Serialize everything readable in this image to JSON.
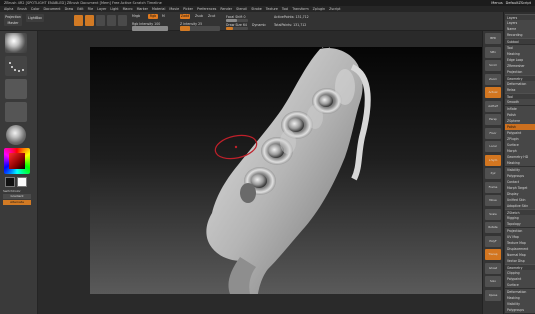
{
  "window": {
    "title": "ZBrush 4R2 [SPOTLIGHT ENABLED]  ZBrush Document  [Mem] Free  Active  Scratch  Timeline",
    "menus_label": "Menus",
    "default_script_label": "DefaultZScript"
  },
  "menubar": {
    "items": [
      "Alpha",
      "Brush",
      "Color",
      "Document",
      "Draw",
      "Edit",
      "File",
      "Layer",
      "Light",
      "Macro",
      "Marker",
      "Material",
      "Movie",
      "Picker",
      "Preferences",
      "Render",
      "Stencil",
      "Stroke",
      "Texture",
      "Tool",
      "Transform",
      "Zplugin",
      "Zscript"
    ]
  },
  "toolbar": {
    "projection_master": "Projection Master",
    "lightbox": "LightBox",
    "edit": "Edit",
    "draw": "Draw",
    "move": "Move",
    "scale": "Scale",
    "rotate": "Rotate",
    "mrgb": "Mrgb",
    "rgb": "Rgb",
    "m": "M",
    "zadd": "Zadd",
    "zsub": "Zsub",
    "zcut": "Zcut",
    "rgb_intensity": "Rgb Intensity 100",
    "z_intensity": "Z Intensity 25",
    "focal_shift": "Focal Shift 0",
    "draw_size": "Draw Size 64",
    "active_points": "ActivePoints: 131,712",
    "total_points": "TotalPoints: 131,712",
    "dynamic": "Dynamic",
    "rgb_intensity_level": 1.0,
    "z_intensity_level": 0.25,
    "focal_shift_level": 0.5,
    "draw_size_level": 0.3
  },
  "left_shelf": {
    "switch_color": "SwitchColor",
    "gradient": "Gradient",
    "alternate": "Alternate"
  },
  "right_shelf": {
    "buttons": [
      "BPR",
      "SPix",
      "Scroll",
      "Zoom",
      "Actual",
      "AAHalf",
      "Persp",
      "Floor",
      "Local",
      "L.Sym",
      "Xyz",
      "Frame",
      "Move",
      "Scale",
      "Rotate",
      "PolyF",
      "Transp",
      "Ghost",
      "Solo",
      "Xpose"
    ]
  },
  "tray": {
    "items": [
      {
        "label": "Layers",
        "style": "hdr"
      },
      {
        "label": "Layers",
        "style": "btn"
      },
      {
        "label": "Name",
        "style": "btn"
      },
      {
        "label": "Recording",
        "style": "btn"
      },
      {
        "label": "Subtool",
        "style": "hdr"
      },
      {
        "label": "Tool",
        "style": "btn"
      },
      {
        "label": "Masking",
        "style": "btn"
      },
      {
        "label": "Edge Loop",
        "style": "btn"
      },
      {
        "label": "ZRemesher",
        "style": "btn"
      },
      {
        "label": "Projection",
        "style": "btn"
      },
      {
        "label": "Geometry",
        "style": "hdr"
      },
      {
        "label": "Deformation",
        "style": "btn"
      },
      {
        "label": "Relax",
        "style": "btn"
      },
      {
        "label": "Tool",
        "style": "hdr"
      },
      {
        "label": "Smooth",
        "style": "btn"
      },
      {
        "label": "Inflate",
        "style": "btn"
      },
      {
        "label": "Polish",
        "style": "btn"
      },
      {
        "label": "ZSphere",
        "style": "btn"
      },
      {
        "label": "Polish",
        "style": "hl"
      },
      {
        "label": "Polypaint",
        "style": "btn"
      },
      {
        "label": "ZPlugin",
        "style": "btn"
      },
      {
        "label": "Surface",
        "style": "btn"
      },
      {
        "label": "Morph",
        "style": "btn"
      },
      {
        "label": "Geometry HD",
        "style": "btn"
      },
      {
        "label": "Masking",
        "style": "btn"
      },
      {
        "label": "Visibility",
        "style": "btn"
      },
      {
        "label": "Polygroups",
        "style": "btn"
      },
      {
        "label": "Contact",
        "style": "btn"
      },
      {
        "label": "Morph Target",
        "style": "btn"
      },
      {
        "label": "Display",
        "style": "btn"
      },
      {
        "label": "Unified Skin",
        "style": "btn"
      },
      {
        "label": "Adaptive Skin",
        "style": "btn"
      },
      {
        "label": "ZSketch",
        "style": "hdr"
      },
      {
        "label": "Rigging",
        "style": "btn"
      },
      {
        "label": "Topology",
        "style": "btn"
      },
      {
        "label": "Projection",
        "style": "btn"
      },
      {
        "label": "UV Map",
        "style": "btn"
      },
      {
        "label": "Texture Map",
        "style": "btn"
      },
      {
        "label": "Displacement",
        "style": "btn"
      },
      {
        "label": "Normal Map",
        "style": "btn"
      },
      {
        "label": "Vector Disp",
        "style": "btn"
      },
      {
        "label": "Geometry",
        "style": "hdr"
      },
      {
        "label": "Clipping",
        "style": "btn"
      },
      {
        "label": "Polypaint",
        "style": "btn"
      },
      {
        "label": "Surface",
        "style": "btn"
      },
      {
        "label": "Deformation",
        "style": "btn"
      },
      {
        "label": "Masking",
        "style": "btn"
      },
      {
        "label": "Visibility",
        "style": "btn"
      },
      {
        "label": "Polygroups",
        "style": "btn"
      }
    ]
  },
  "colors": {
    "accent_orange": "#d27a24",
    "brush_cursor_red": "#c0202a",
    "sculpt_surface": "#c8c8c8"
  }
}
